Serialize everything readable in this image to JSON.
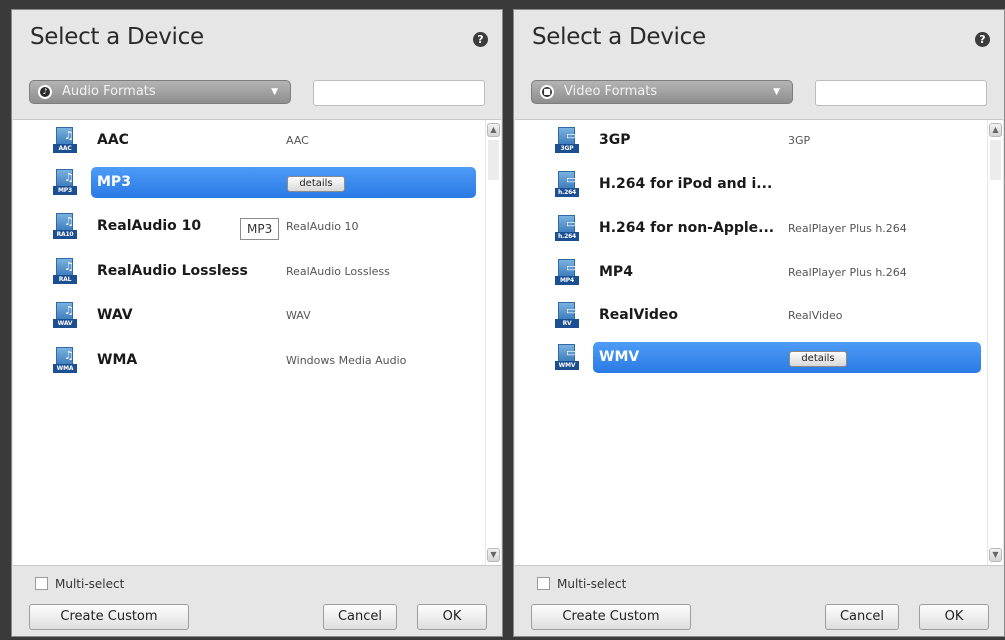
{
  "dialogs": [
    {
      "title": "Select a Device",
      "format_select": {
        "value": "Audio Formats",
        "icon": "audio-icon"
      },
      "search_placeholder": "",
      "items": [
        {
          "name": "AAC",
          "icon_tag": "AAC",
          "description": "AAC"
        },
        {
          "name": "MP3",
          "icon_tag": "MP3",
          "description": "",
          "selected": true,
          "details_label": "details"
        },
        {
          "name": "RealAudio 10",
          "icon_tag": "RA10",
          "description": "RealAudio 10"
        },
        {
          "name": "RealAudio Lossless",
          "icon_tag": "RAL",
          "description": "RealAudio Lossless"
        },
        {
          "name": "WAV",
          "icon_tag": "WAV",
          "description": "WAV"
        },
        {
          "name": "WMA",
          "icon_tag": "WMA",
          "description": "Windows Media Audio"
        }
      ],
      "tooltip": "MP3",
      "multiselect_label": "Multi-select",
      "buttons": {
        "create": "Create Custom",
        "cancel": "Cancel",
        "ok": "OK"
      }
    },
    {
      "title": "Select a Device",
      "format_select": {
        "value": "Video Formats",
        "icon": "video-icon"
      },
      "search_placeholder": "",
      "items": [
        {
          "name": "3GP",
          "icon_tag": "3GP",
          "description": "3GP"
        },
        {
          "name": "H.264 for iPod and i...",
          "icon_tag": "h.264",
          "description": ""
        },
        {
          "name": "H.264 for non-Apple...",
          "icon_tag": "h.264",
          "description": "RealPlayer Plus h.264"
        },
        {
          "name": "MP4",
          "icon_tag": "MP4",
          "description": "RealPlayer Plus h.264"
        },
        {
          "name": "RealVideo",
          "icon_tag": "RV",
          "description": "RealVideo"
        },
        {
          "name": "WMV",
          "icon_tag": "WMV",
          "description": "",
          "selected": true,
          "details_label": "details"
        }
      ],
      "multiselect_label": "Multi-select",
      "buttons": {
        "create": "Create Custom",
        "cancel": "Cancel",
        "ok": "OK"
      }
    }
  ]
}
